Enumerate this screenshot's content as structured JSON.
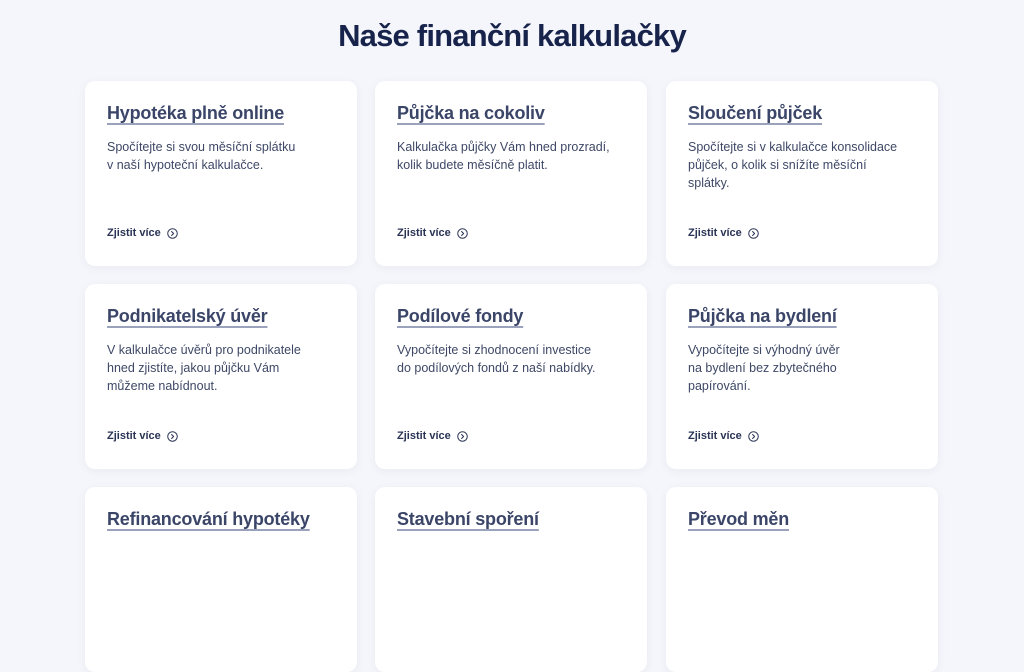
{
  "page": {
    "title": "Naše finanční kalkulačky"
  },
  "cards": [
    {
      "title": "Hypotéka plně online",
      "description": "Spočítejte si svou měsíční splátku\nv naší hypoteční kalkulačce.",
      "link_label": "Zjistit více"
    },
    {
      "title": "Půjčka na cokoliv",
      "description": "Kalkulačka půjčky Vám hned prozradí,\nkolik budete měsíčně platit.",
      "link_label": "Zjistit více"
    },
    {
      "title": "Sloučení půjček",
      "description": "Spočítejte si v kalkulačce konsolidace\npůjček, o kolik si snížíte měsíční\nsplátky.",
      "link_label": "Zjistit více"
    },
    {
      "title": "Podnikatelský úvěr",
      "description": "V kalkulačce úvěrů pro podnikatele\nhned zjistíte, jakou půjčku Vám\nmůžeme nabídnout.",
      "link_label": "Zjistit více"
    },
    {
      "title": "Podílové fondy",
      "description": "Vypočítejte si zhodnocení investice\ndo podílových fondů z naší nabídky.",
      "link_label": "Zjistit více"
    },
    {
      "title": "Půjčka na bydlení",
      "description": "Vypočítejte si výhodný úvěr\nna bydlení bez zbytečného\npapírování.",
      "link_label": "Zjistit více"
    },
    {
      "title": "Refinancování hypotéky"
    },
    {
      "title": "Stavební spoření"
    },
    {
      "title": "Převod měn"
    }
  ],
  "icons": {
    "link_icon": "circled-chevron-right-icon"
  }
}
